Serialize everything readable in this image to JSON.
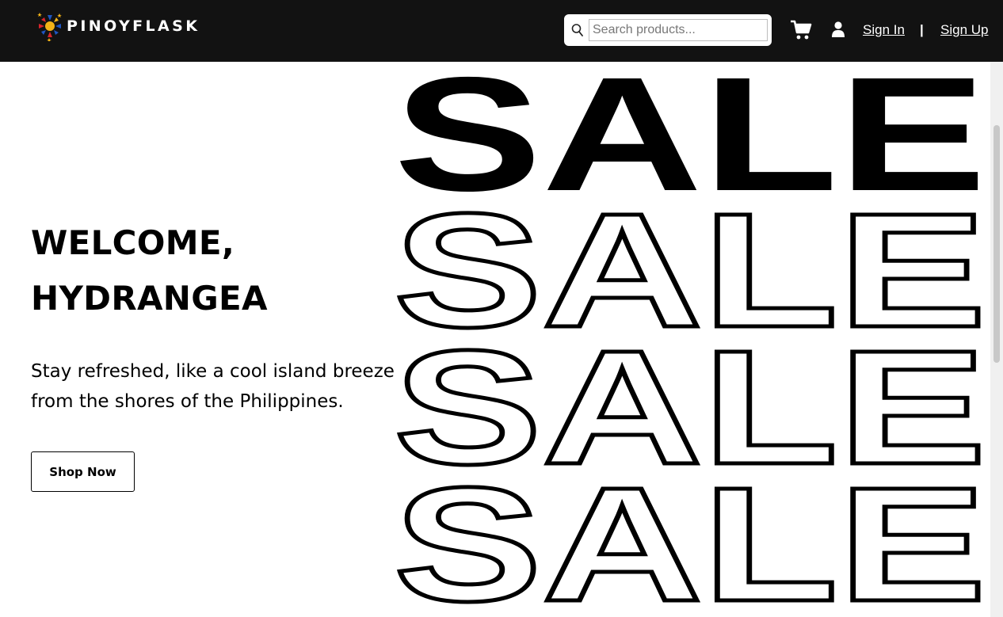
{
  "header": {
    "logo_text": "PINOYFLASK",
    "search": {
      "placeholder": "Search products...",
      "value": ""
    },
    "sign_in": "Sign In",
    "separator": "|",
    "sign_up": "Sign Up"
  },
  "hero": {
    "greeting": "WELCOME, HYDRANGEA",
    "tagline": "Stay refreshed, like a cool island breeze\nfrom the shores of the Philippines.",
    "cta": "Shop Now",
    "sale_word": "SALE"
  },
  "colors": {
    "navbar_bg": "#121212",
    "page_bg": "#ffffff",
    "text": "#000000",
    "nav_text": "#ffffff"
  },
  "icons": [
    "logo-sun-icon",
    "search-icon",
    "cart-icon",
    "user-icon"
  ]
}
